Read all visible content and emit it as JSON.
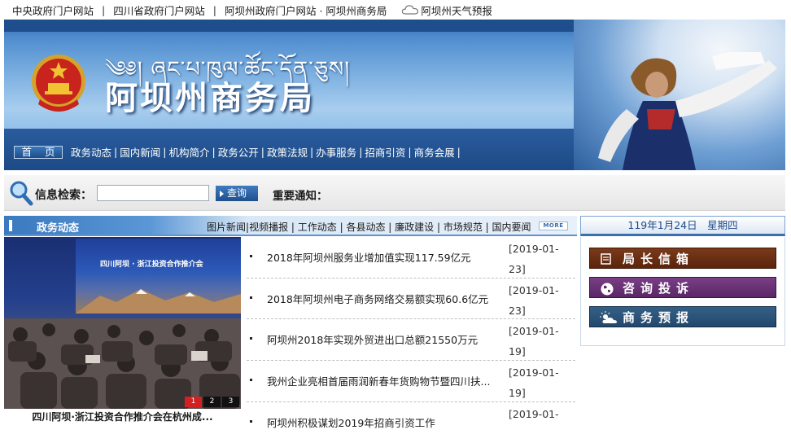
{
  "top_links": [
    "中央政府门户网站",
    "四川省政府门户网站",
    "阿坝州政府门户网站 · 阿坝州商务局",
    "阿坝州天气预报"
  ],
  "banner": {
    "tibetan_title": "༄༅། ཞང་པ་ཁུལ་ཚོང་དོན་ཅུས།",
    "site_name": "阿坝州商务局"
  },
  "nav": {
    "home": "首 页",
    "items": [
      "政务动态",
      "国内新闻",
      "机构简介",
      "政务公开",
      "政策法规",
      "办事服务",
      "招商引资",
      "商务会展"
    ]
  },
  "search": {
    "label": "信息检索：",
    "input_value": "",
    "button": "查询",
    "notice_label": "重要通知："
  },
  "news_section": {
    "title": "政务动态",
    "categories": [
      "图片新闻",
      "视频播报",
      "工作动态",
      "各县动态",
      "廉政建设",
      "市场规范",
      "国内要闻"
    ],
    "more": "MORE"
  },
  "slideshow": {
    "screen_title": "四川阿坝 · 浙江投资合作推介会",
    "caption": "四川阿坝·浙江投资合作推介会在杭州成...",
    "pages": [
      "1",
      "2",
      "3"
    ],
    "active_page": "1"
  },
  "news": [
    {
      "title": "2018年阿坝州服务业增加值实现117.59亿元",
      "date": "[2019-01-23]"
    },
    {
      "title": "2018年阿坝州电子商务网络交易额实现60.6亿元",
      "date": "[2019-01-23]"
    },
    {
      "title": "阿坝州2018年实现外贸进出口总额21550万元",
      "date": "[2019-01-19]"
    },
    {
      "title": "我州企业亮相首届雨润新春年货购物节暨四川扶...",
      "date": "[2019-01-19]"
    },
    {
      "title": "阿坝州积极谋划2019年招商引资工作",
      "date": "[2019-01-"
    }
  ],
  "date_bar": "119年1月24日　星期四",
  "right_buttons": [
    {
      "label": "局长信箱",
      "icon": "mailbox-icon"
    },
    {
      "label": "咨询投诉",
      "icon": "globe-icon"
    },
    {
      "label": "商务预报",
      "icon": "weather-icon"
    }
  ]
}
